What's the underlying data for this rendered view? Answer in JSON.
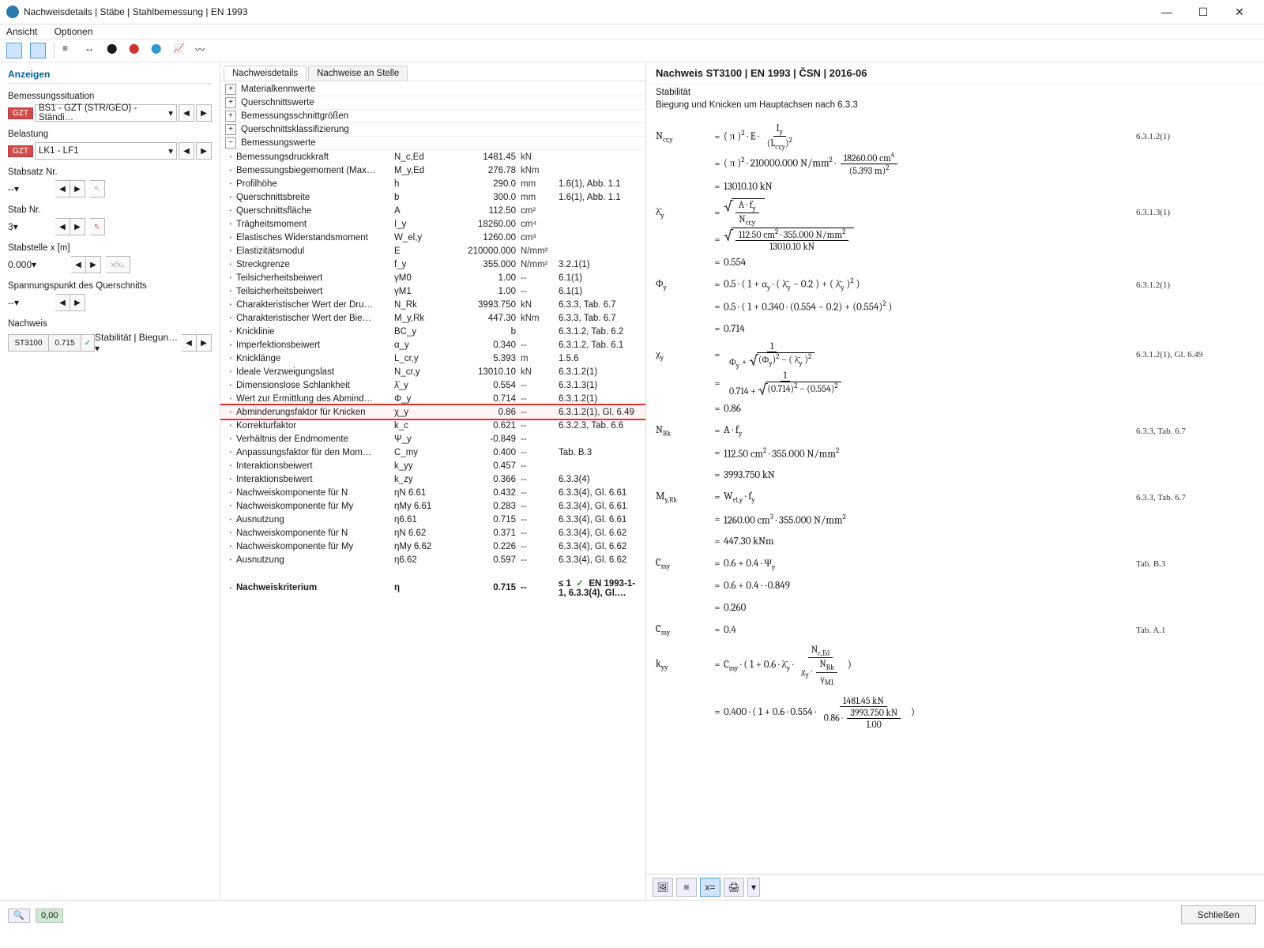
{
  "window_title": "Nachweisdetails | Stäbe | Stahlbemessung | EN 1993",
  "menu": [
    "Ansicht",
    "Optionen"
  ],
  "left": {
    "title": "Anzeigen",
    "situation_lbl": "Bemessungssituation",
    "situation_pill": "GZT",
    "situation_val": "BS1 - GZT (STR/GEO) - Ständi…",
    "loading_lbl": "Belastung",
    "loading_pill": "GZT",
    "loading_val": "LK1 - LF1",
    "stabsatz_lbl": "Stabsatz Nr.",
    "stabsatz_val": "--",
    "stab_lbl": "Stab Nr.",
    "stab_val": "3",
    "stelle_lbl": "Stabstelle x [m]",
    "stelle_val": "0.000",
    "sp_lbl": "Spannungspunkt des Querschnitts",
    "sp_val": "--",
    "nachweis_lbl": "Nachweis",
    "nachweis_code": "ST3100",
    "nachweis_ratio": "0.715",
    "nachweis_txt": "Stabilität | Biegun…"
  },
  "mid": {
    "tab1": "Nachweisdetails",
    "tab2": "Nachweise an Stelle",
    "sections": [
      "Materialkennwerte",
      "Querschnittswerte",
      "Bemessungsschnittgrößen",
      "Querschnittsklassifizierung",
      "Bemessungswerte"
    ],
    "rows": [
      {
        "n": "Bemessungsdruckkraft",
        "s": "N_c,Ed",
        "v": "1481.45",
        "u": "kN",
        "r": ""
      },
      {
        "n": "Bemessungsbiegemoment (Max…",
        "s": "M_y,Ed",
        "v": "276.78",
        "u": "kNm",
        "r": ""
      },
      {
        "n": "Profilhöhe",
        "s": "h",
        "v": "290.0",
        "u": "mm",
        "r": "1.6(1), Abb. 1.1"
      },
      {
        "n": "Querschnittsbreite",
        "s": "b",
        "v": "300.0",
        "u": "mm",
        "r": "1.6(1), Abb. 1.1"
      },
      {
        "n": "Querschnittsfläche",
        "s": "A",
        "v": "112.50",
        "u": "cm²",
        "r": ""
      },
      {
        "n": "Trägheitsmoment",
        "s": "I_y",
        "v": "18260.00",
        "u": "cm⁴",
        "r": ""
      },
      {
        "n": "Elastisches Widerstandsmoment",
        "s": "W_el,y",
        "v": "1260.00",
        "u": "cm³",
        "r": ""
      },
      {
        "n": "Elastizitätsmodul",
        "s": "E",
        "v": "210000.000",
        "u": "N/mm²",
        "r": ""
      },
      {
        "n": "Streckgrenze",
        "s": "f_y",
        "v": "355.000",
        "u": "N/mm²",
        "r": "3.2.1(1)"
      },
      {
        "n": "Teilsicherheitsbeiwert",
        "s": "γM0",
        "v": "1.00",
        "u": "--",
        "r": "6.1(1)"
      },
      {
        "n": "Teilsicherheitsbeiwert",
        "s": "γM1",
        "v": "1.00",
        "u": "--",
        "r": "6.1(1)"
      },
      {
        "n": "Charakteristischer Wert der Dru…",
        "s": "N_Rk",
        "v": "3993.750",
        "u": "kN",
        "r": "6.3.3, Tab. 6.7"
      },
      {
        "n": "Charakteristischer Wert der Bie…",
        "s": "M_y,Rk",
        "v": "447.30",
        "u": "kNm",
        "r": "6.3.3, Tab. 6.7"
      },
      {
        "n": "Knicklinie",
        "s": "BC_y",
        "v": "b",
        "u": "",
        "r": "6.3.1.2, Tab. 6.2"
      },
      {
        "n": "Imperfektionsbeiwert",
        "s": "α_y",
        "v": "0.340",
        "u": "--",
        "r": "6.3.1.2, Tab. 6.1"
      },
      {
        "n": "Knicklänge",
        "s": "L_cr,y",
        "v": "5.393",
        "u": "m",
        "r": "1.5.6"
      },
      {
        "n": "Ideale Verzweigungslast",
        "s": "N_cr,y",
        "v": "13010.10",
        "u": "kN",
        "r": "6.3.1.2(1)"
      },
      {
        "n": "Dimensionslose Schlankheit",
        "s": "λ̄_y",
        "v": "0.554",
        "u": "--",
        "r": "6.3.1.3(1)"
      },
      {
        "n": "Wert zur Ermittlung des Abmind…",
        "s": "Φ_y",
        "v": "0.714",
        "u": "--",
        "r": "6.3.1.2(1)"
      },
      {
        "n": "Abminderungsfaktor für Knicken",
        "s": "χ_y",
        "v": "0.86",
        "u": "--",
        "r": "6.3.1.2(1), Gl. 6.49",
        "hl": true
      },
      {
        "n": "Korrekturfaktor",
        "s": "k_c",
        "v": "0.621",
        "u": "--",
        "r": "6.3.2.3, Tab. 6.6"
      },
      {
        "n": "Verhältnis der Endmomente",
        "s": "Ψ_y",
        "v": "-0.849",
        "u": "--",
        "r": ""
      },
      {
        "n": "Anpassungsfaktor für den Mom…",
        "s": "C_my",
        "v": "0.400",
        "u": "--",
        "r": "Tab. B.3"
      },
      {
        "n": "Interaktionsbeiwert",
        "s": "k_yy",
        "v": "0.457",
        "u": "--",
        "r": ""
      },
      {
        "n": "Interaktionsbeiwert",
        "s": "k_zy",
        "v": "0.366",
        "u": "--",
        "r": "6.3.3(4)"
      },
      {
        "n": "Nachweiskomponente für N",
        "s": "ηN 6.61",
        "v": "0.432",
        "u": "--",
        "r": "6.3.3(4), Gl. 6.61"
      },
      {
        "n": "Nachweiskomponente für My",
        "s": "ηMy 6.61",
        "v": "0.283",
        "u": "--",
        "r": "6.3.3(4), Gl. 6.61"
      },
      {
        "n": "Ausnutzung",
        "s": "η6.61",
        "v": "0.715",
        "u": "--",
        "r": "6.3.3(4), Gl. 6.61"
      },
      {
        "n": "Nachweiskomponente für N",
        "s": "ηN 6.62",
        "v": "0.371",
        "u": "--",
        "r": "6.3.3(4), Gl. 6.62"
      },
      {
        "n": "Nachweiskomponente für My",
        "s": "ηMy 6.62",
        "v": "0.226",
        "u": "--",
        "r": "6.3.3(4), Gl. 6.62"
      },
      {
        "n": "Ausnutzung",
        "s": "η6.62",
        "v": "0.597",
        "u": "--",
        "r": "6.3.3(4), Gl. 6.62"
      }
    ],
    "crit": {
      "n": "Nachweiskriterium",
      "s": "η",
      "v": "0.715",
      "u": "--",
      "cond": "≤ 1",
      "r": "EN 1993-1-1, 6.3.3(4), Gl.…"
    }
  },
  "right": {
    "title": "Nachweis ST3100 | EN 1993 | ČSN | 2016-06",
    "sub1": "Stabilität",
    "sub2": "Biegung und Knicken um Hauptachsen nach 6.3.3"
  },
  "close_btn": "Schließen"
}
